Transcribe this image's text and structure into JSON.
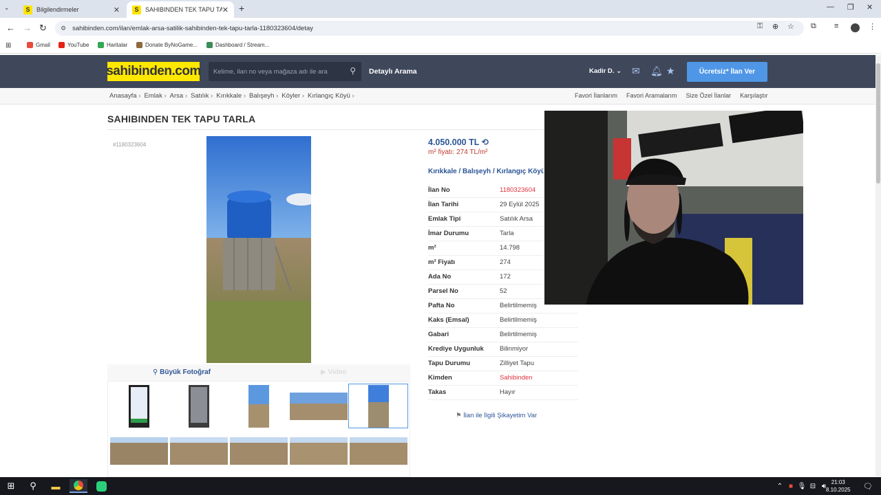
{
  "browser": {
    "tabs": [
      {
        "title": "Bilgilendirmeler",
        "favicon": "S"
      },
      {
        "title": "SAHIBINDEN TEK TAPU TARLA",
        "favicon": "S"
      }
    ],
    "url": "sahibinden.com/ilan/emlak-arsa-satilik-sahibinden-tek-tapu-tarla-1180323604/detay",
    "bookmarks": [
      "Gmail",
      "YouTube",
      "Haritalar",
      "Donate ByNoGame...",
      "Dashboard / Stream..."
    ]
  },
  "header": {
    "logo": "sahibinden.com",
    "search_placeholder": "Kelime, ilan no veya mağaza adı ile ara",
    "advanced_search": "Detaylı Arama",
    "user": "Kadir D.",
    "post_button": "Ücretsiz* İlan Ver"
  },
  "breadcrumb": [
    "Anasayfa",
    "Emlak",
    "Arsa",
    "Satılık",
    "Kırıkkale",
    "Balışeyh",
    "Köyler",
    "Kırlangıç Köyü"
  ],
  "top_links": [
    "Favori İlanlarım",
    "Favori Aramalarım",
    "Size Özel İlanlar",
    "Karşılaştır"
  ],
  "listing": {
    "title": "SAHIBINDEN TEK TAPU TARLA",
    "number_tag": "#1180323604",
    "price": "4.050.000 TL",
    "sqm_price_label": "m² fiyatı: 274 TL/m²",
    "location": "Kırıkkale  /  Balışeyh  /  Kırlangıç Köyü",
    "big_photo": "Büyük Fotoğraf",
    "video": "Video",
    "complaint": "İlan ile İlgili Şikayetim Var",
    "details": [
      {
        "k": "İlan No",
        "v": "1180323604"
      },
      {
        "k": "İlan Tarihi",
        "v": "29 Eylül 2025"
      },
      {
        "k": "Emlak Tipi",
        "v": "Satılık Arsa"
      },
      {
        "k": "İmar Durumu",
        "v": "Tarla"
      },
      {
        "k": "m²",
        "v": "14.798"
      },
      {
        "k": "m² Fiyatı",
        "v": "274"
      },
      {
        "k": "Ada No",
        "v": "172"
      },
      {
        "k": "Parsel No",
        "v": "52"
      },
      {
        "k": "Pafta No",
        "v": "Belirtilmemiş"
      },
      {
        "k": "Kaks (Emsal)",
        "v": "Belirtilmemiş"
      },
      {
        "k": "Gabari",
        "v": "Belirtilmemiş"
      },
      {
        "k": "Krediye Uygunluk",
        "v": "Bilinmiyor"
      },
      {
        "k": "Tapu Durumu",
        "v": "Zilliyet Tapu"
      },
      {
        "k": "Kimden",
        "v": "Sahibinden"
      },
      {
        "k": "Takas",
        "v": "Hayır"
      }
    ]
  },
  "taskbar": {
    "time": "21:03",
    "date": "8.10.2025"
  },
  "colors": {
    "brand_yellow": "#ffe800",
    "header_bg": "#3f475a",
    "link_blue": "#2b5595",
    "accent_red": "#e0323c",
    "button_blue": "#4f97e6"
  }
}
